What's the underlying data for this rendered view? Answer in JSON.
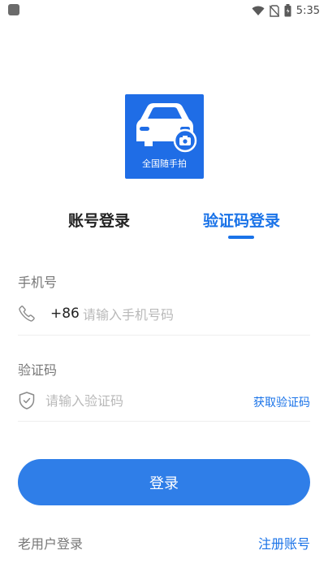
{
  "status_bar": {
    "time": "5:35",
    "icons": [
      "app-notification-icon",
      "wifi-icon",
      "no-sim-icon",
      "battery-icon"
    ]
  },
  "logo": {
    "caption": "全国随手拍",
    "background_color": "#1f6de6"
  },
  "tabs": [
    {
      "label": "账号登录",
      "active": false
    },
    {
      "label": "验证码登录",
      "active": true
    }
  ],
  "form": {
    "phone": {
      "label": "手机号",
      "country_code": "+86",
      "placeholder": "请输入手机号码",
      "icon": "phone-icon"
    },
    "code": {
      "label": "验证码",
      "placeholder": "请输入验证码",
      "icon": "shield-icon",
      "get_code_label": "获取验证码"
    },
    "submit_label": "登录"
  },
  "footer": {
    "old_user_label": "老用户登录",
    "register_label": "注册账号"
  },
  "colors": {
    "accent": "#1a73e8",
    "button": "#2f7ee8"
  }
}
